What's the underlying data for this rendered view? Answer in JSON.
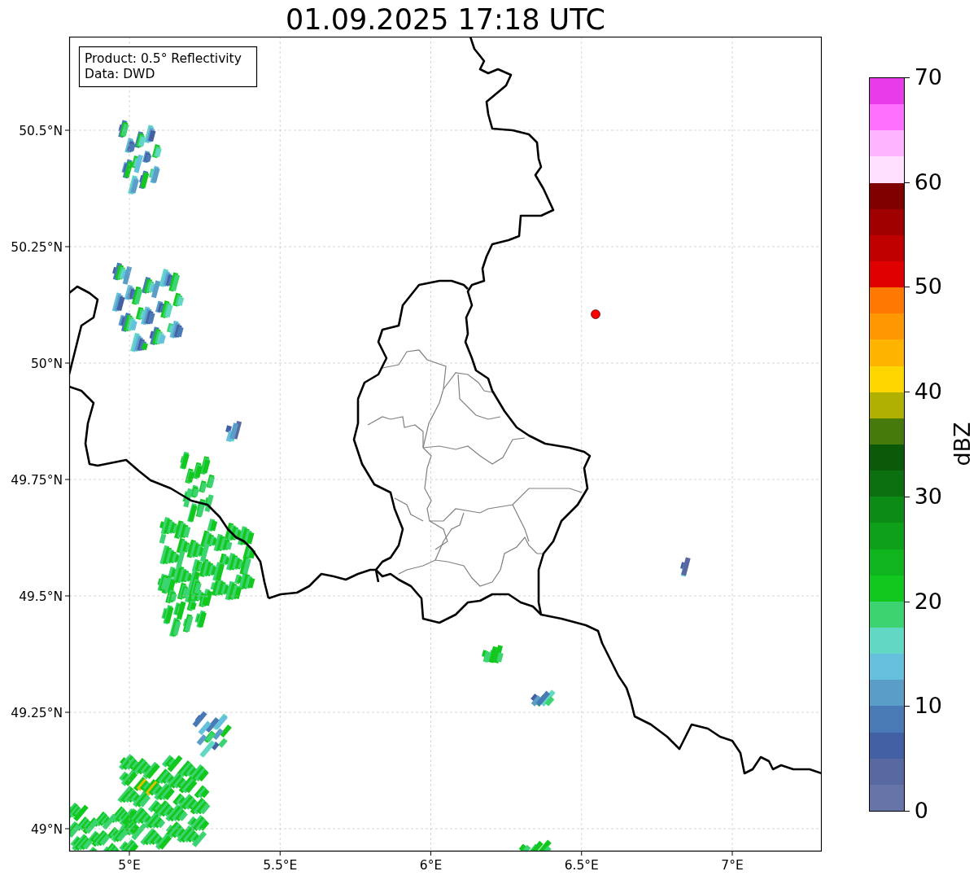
{
  "title": "01.09.2025 17:18 UTC",
  "map": {
    "legend": [
      "Product: 0.5° Reflectivity",
      "Data: DWD"
    ],
    "y_ticks": [
      "50.5°N",
      "50.25°N",
      "50°N",
      "49.75°N",
      "49.5°N",
      "49.25°N",
      "49°N"
    ],
    "x_ticks": [
      "5°E",
      "5.5°E",
      "6°E",
      "6.5°E",
      "7°E"
    ]
  },
  "colorbar": {
    "label": "dBZ",
    "ticks": [
      "70",
      "60",
      "50",
      "40",
      "30",
      "20",
      "10",
      "0"
    ]
  }
}
